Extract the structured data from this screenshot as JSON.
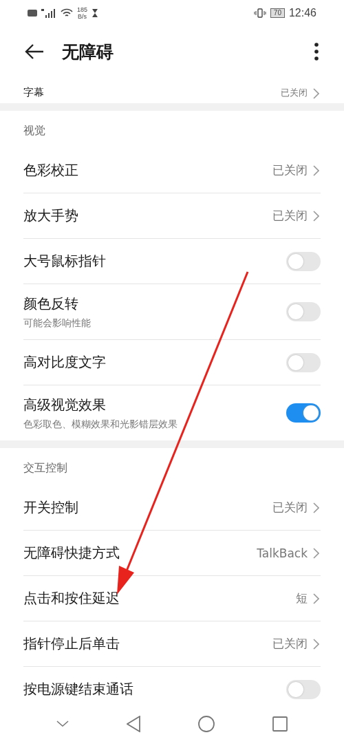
{
  "status_bar": {
    "speed": "185",
    "speed_unit": "B/s",
    "battery": "70",
    "time": "12:46"
  },
  "header": {
    "title": "无障碍"
  },
  "sections": [
    {
      "items": [
        {
          "kind": "link",
          "label": "字幕",
          "value": "已关闭"
        }
      ]
    },
    {
      "title": "视觉",
      "items": [
        {
          "kind": "link",
          "label": "色彩校正",
          "value": "已关闭"
        },
        {
          "kind": "link",
          "label": "放大手势",
          "value": "已关闭"
        },
        {
          "kind": "toggle",
          "label": "大号鼠标指针",
          "on": false
        },
        {
          "kind": "toggle",
          "label": "颜色反转",
          "subtitle": "可能会影响性能",
          "on": false
        },
        {
          "kind": "toggle",
          "label": "高对比度文字",
          "on": false
        },
        {
          "kind": "toggle",
          "label": "高级视觉效果",
          "subtitle": "色彩取色、模糊效果和光影错层效果",
          "on": true
        }
      ]
    },
    {
      "title": "交互控制",
      "items": [
        {
          "kind": "link",
          "label": "开关控制",
          "value": "已关闭"
        },
        {
          "kind": "link",
          "label": "无障碍快捷方式",
          "value": "TalkBack"
        },
        {
          "kind": "link",
          "label": "点击和按住延迟",
          "value": "短"
        },
        {
          "kind": "link",
          "label": "指针停止后单击",
          "value": "已关闭"
        },
        {
          "kind": "toggle",
          "label": "按电源键结束通话",
          "on": false
        }
      ]
    }
  ]
}
